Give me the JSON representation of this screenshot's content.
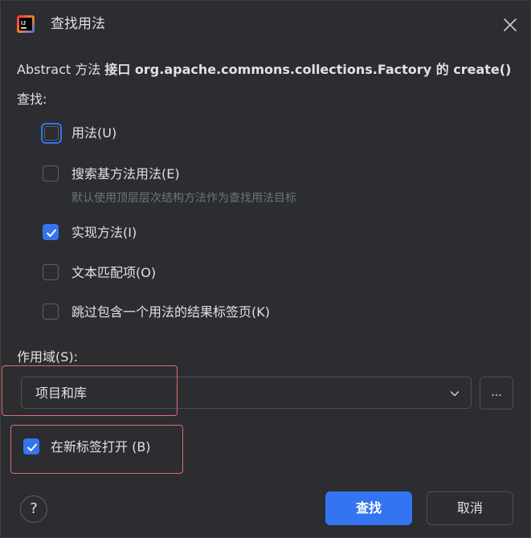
{
  "dialog": {
    "title": "查找用法",
    "subject_prefix": "Abstract 方法 ",
    "subject_bold": "接口 org.apache.commons.collections.Factory 的 create()"
  },
  "find": {
    "label": "查找:",
    "options": [
      {
        "label": "用法(U)",
        "checked": false
      },
      {
        "label": "搜索基方法用法(E)",
        "checked": false
      },
      {
        "label": "实现方法(I)",
        "checked": true
      },
      {
        "label": "文本匹配项(O)",
        "checked": false
      },
      {
        "label": "跳过包含一个用法的结果标签页(K)",
        "checked": false
      }
    ],
    "base_method_hint": "默认使用顶层层次结构方法作为查找用法目标"
  },
  "scope": {
    "label": "作用域(S):",
    "value": "项目和库",
    "more_label": "..."
  },
  "open_in_new_tab": {
    "label": "在新标签打开 (B)",
    "checked": true
  },
  "footer": {
    "help_label": "?",
    "find_label": "查找",
    "cancel_label": "取消"
  },
  "colors": {
    "accent": "#3574f0",
    "background": "#2b2d30",
    "highlight": "#e06c75"
  }
}
